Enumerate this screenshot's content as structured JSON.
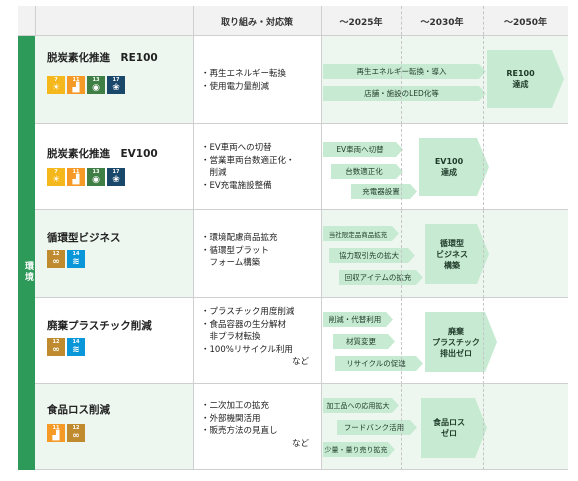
{
  "header": {
    "measures": "取り組み・対応策",
    "col2025": "～2025年",
    "col2030": "～2030年",
    "col2050": "～2050年"
  },
  "side_label": "環境",
  "rows": [
    {
      "title": "脱炭素化推進　RE100",
      "sdgs": [
        {
          "num": "7",
          "icon": "sun-icon",
          "color": "#f5b81c"
        },
        {
          "num": "11",
          "icon": "city-icon",
          "color": "#f59a26"
        },
        {
          "num": "13",
          "icon": "eye-globe-icon",
          "color": "#3f7e44"
        },
        {
          "num": "17",
          "icon": "flower-icon",
          "color": "#19486a"
        }
      ],
      "measures": [
        "・再生エネルギー転換",
        "・使用電力量削減"
      ],
      "etc": "",
      "arrows": [
        "再生エネルギー転換・導入",
        "店舗・施設のLED化等"
      ],
      "goal": "RE100\n達成"
    },
    {
      "title": "脱炭素化推進　EV100",
      "sdgs": [
        {
          "num": "7",
          "icon": "sun-icon",
          "color": "#f5b81c"
        },
        {
          "num": "11",
          "icon": "city-icon",
          "color": "#f59a26"
        },
        {
          "num": "13",
          "icon": "eye-globe-icon",
          "color": "#3f7e44"
        },
        {
          "num": "17",
          "icon": "flower-icon",
          "color": "#19486a"
        }
      ],
      "measures": [
        "・EV車両への切替",
        "・営業車両台数適正化・",
        "　削減",
        "・EV充電施設整備"
      ],
      "etc": "",
      "arrows": [
        "EV車両へ切替",
        "台数適正化",
        "充電器設置"
      ],
      "goal": "EV100\n達成"
    },
    {
      "title": "循環型ビジネス",
      "sdgs": [
        {
          "num": "12",
          "icon": "infinity-icon",
          "color": "#bf8b2e"
        },
        {
          "num": "14",
          "icon": "fish-icon",
          "color": "#0a97d9"
        }
      ],
      "measures": [
        "・環境配慮商品拡充",
        "・循環型プラット",
        "　フォーム構築"
      ],
      "etc": "",
      "arrows": [
        "当社限定品商品拡充",
        "協力取引先の拡大",
        "回収アイテムの拡充"
      ],
      "goal": "循環型\nビジネス\n構築"
    },
    {
      "title": "廃棄プラスチック削減",
      "sdgs": [
        {
          "num": "12",
          "icon": "infinity-icon",
          "color": "#bf8b2e"
        },
        {
          "num": "14",
          "icon": "fish-icon",
          "color": "#0a97d9"
        }
      ],
      "measures": [
        "・プラスチック用度削減",
        "・食品容器の生分解材",
        "　非プラ材転換",
        "・100%リサイクル利用"
      ],
      "etc": "など",
      "arrows": [
        "削減・代替利用",
        "材質変更",
        "リサイクルの促進"
      ],
      "goal": "廃棄\nプラスチック\n排出ゼロ"
    },
    {
      "title": "食品ロス削減",
      "sdgs": [
        {
          "num": "11",
          "icon": "city-icon",
          "color": "#f59a26"
        },
        {
          "num": "12",
          "icon": "infinity-icon",
          "color": "#bf8b2e"
        }
      ],
      "measures": [
        "・二次加工の拡充",
        "・外部機関活用",
        "・販売方法の見直し"
      ],
      "etc": "など",
      "arrows": [
        "加工品への応用拡大",
        "フードバンク活用",
        "少量・量り売り拡充"
      ],
      "goal": "食品ロス\nゼロ"
    }
  ]
}
